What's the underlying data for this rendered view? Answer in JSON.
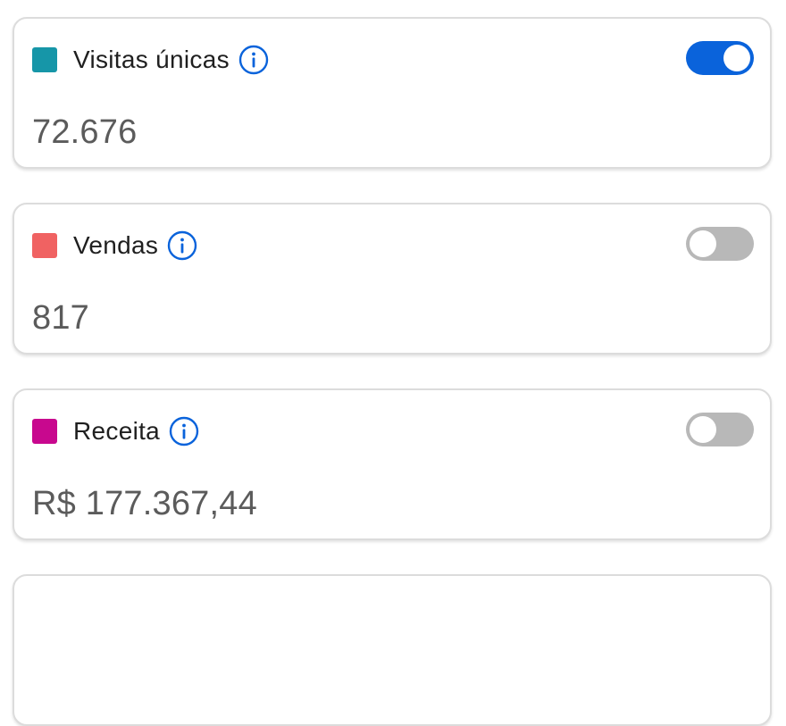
{
  "metrics": [
    {
      "label": "Visitas únicas",
      "value": "72.676",
      "color": "#1696a8",
      "enabled": true
    },
    {
      "label": "Vendas",
      "value": "817",
      "color": "#f06262",
      "enabled": false
    },
    {
      "label": "Receita",
      "value": "R$ 177.367,44",
      "color": "#c8088e",
      "enabled": false
    }
  ],
  "colors": {
    "toggle_on": "#0a63db",
    "toggle_off": "#b8b8b8",
    "info_icon": "#0a63db"
  },
  "icons": {
    "info": "info-circle-icon"
  }
}
